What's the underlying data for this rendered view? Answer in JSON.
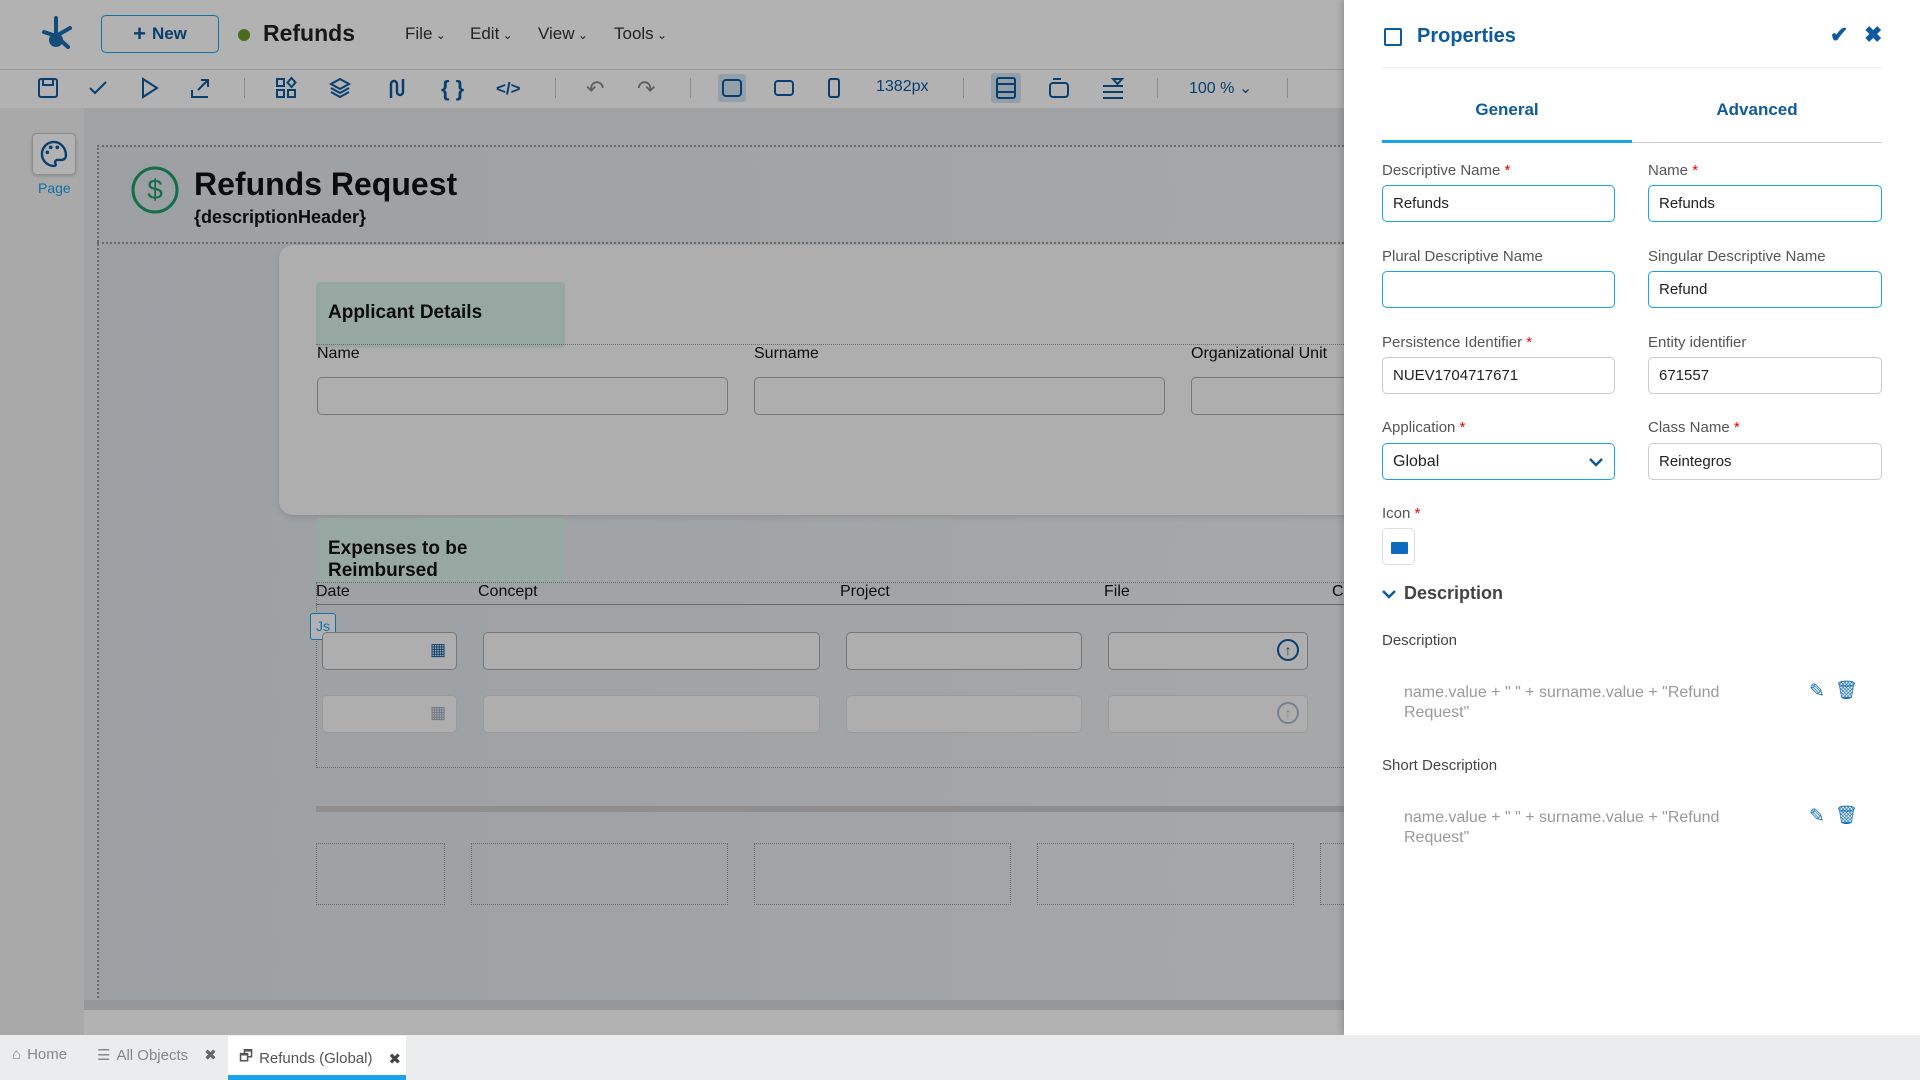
{
  "topbar": {
    "new_label": "New",
    "doc_title": "Refunds",
    "status_color": "#6b9a2a",
    "menus": [
      "File",
      "Edit",
      "View",
      "Tools"
    ]
  },
  "toolbar": {
    "width_value": "1382px",
    "zoom": "100 %"
  },
  "sidebar": {
    "page_label": "Page"
  },
  "canvas": {
    "title": "Refunds Request",
    "subtitle": "{descriptionHeader}",
    "applicant": {
      "header": "Applicant Details",
      "fields": [
        "Name",
        "Surname",
        "Organizational Unit"
      ]
    },
    "expenses": {
      "header": "Expenses to be Reimbursed",
      "columns": [
        "Date",
        "Concept",
        "Project",
        "File",
        "C"
      ],
      "js_badge": "Js"
    }
  },
  "panel": {
    "title": "Properties",
    "tabs": [
      "General",
      "Advanced"
    ],
    "active_tab": "General",
    "fields": {
      "descriptive_name": {
        "label": "Descriptive Name",
        "value": "Refunds"
      },
      "name": {
        "label": "Name",
        "value": "Refunds"
      },
      "plural": {
        "label": "Plural Descriptive Name",
        "value": ""
      },
      "singular": {
        "label": "Singular Descriptive Name",
        "value": "Refund"
      },
      "persistence": {
        "label": "Persistence Identifier",
        "value": "NUEV1704717671"
      },
      "entity": {
        "label": "Entity identifier",
        "value": "671557"
      },
      "application": {
        "label": "Application",
        "value": "Global"
      },
      "class_name": {
        "label": "Class Name",
        "value": "Reintegros"
      },
      "icon": {
        "label": "Icon"
      }
    },
    "description_section": {
      "header": "Description",
      "description": {
        "label": "Description",
        "value": "name.value + \" \" + surname.value + \"Refund Request\""
      },
      "short_description": {
        "label": "Short Description",
        "value": "name.value + \" \" + surname.value + \"Refund Request\""
      }
    },
    "required_mark": "*"
  },
  "bottom_tabs": [
    {
      "label": "Home"
    },
    {
      "label": "All Objects"
    },
    {
      "label": "Refunds (Global)",
      "active": true
    }
  ],
  "colors": {
    "accent": "#1aa3e8",
    "brand": "#0d5a9e",
    "section_header": "#d9efe8",
    "dollar_icon": "#1e9e6a"
  }
}
